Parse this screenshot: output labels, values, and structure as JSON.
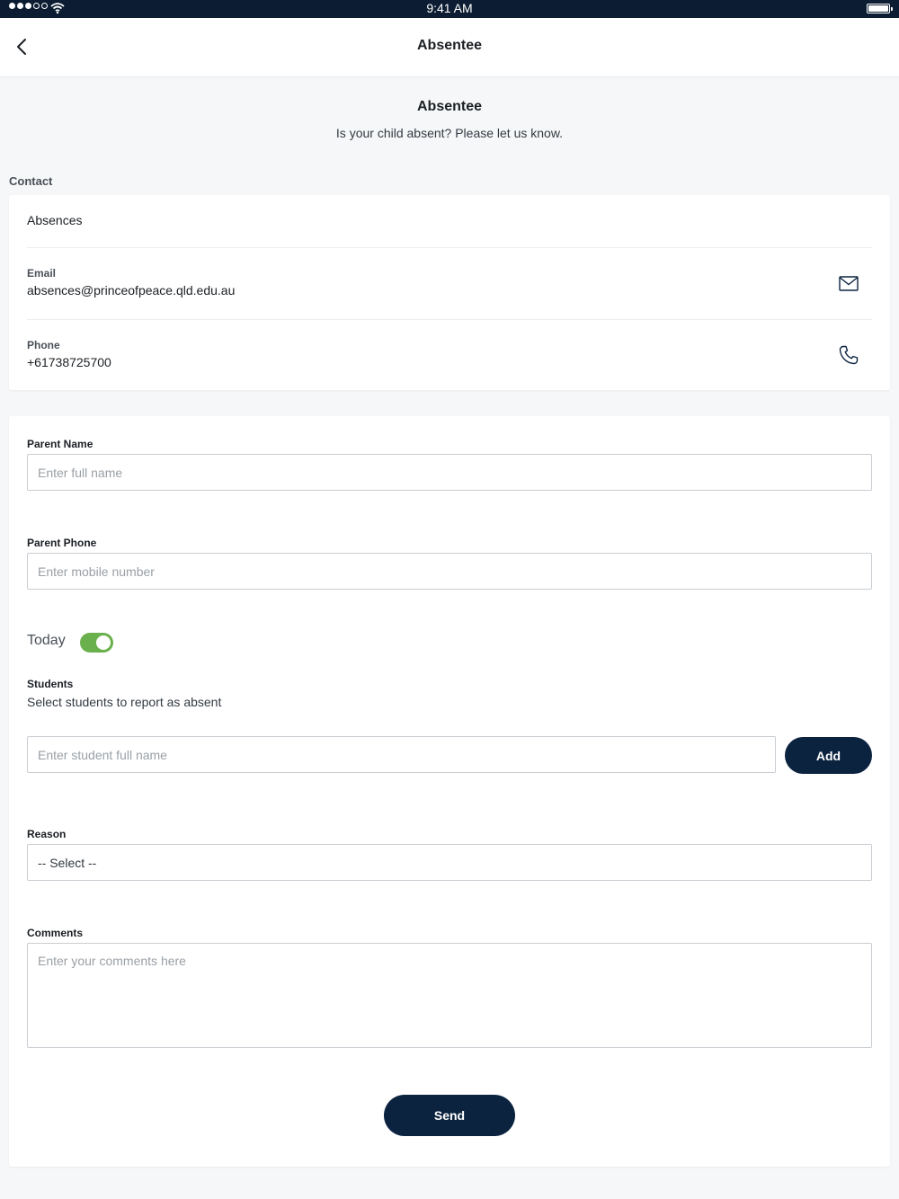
{
  "status_bar": {
    "time": "9:41 AM",
    "signal_icon": "signal-dots-icon",
    "wifi_icon": "wifi-icon",
    "battery_icon": "battery-icon",
    "battery_level": 1.0
  },
  "nav": {
    "title": "Absentee",
    "back_icon": "chevron-left-icon"
  },
  "header": {
    "title": "Absentee",
    "subtitle": "Is your child absent? Please let us know."
  },
  "contact": {
    "section_label": "Contact",
    "heading": "Absences",
    "email": {
      "label": "Email",
      "value": "absences@princeofpeace.qld.edu.au",
      "icon": "mail-icon"
    },
    "phone": {
      "label": "Phone",
      "value": "+61738725700",
      "icon": "phone-icon"
    }
  },
  "form": {
    "parent_name": {
      "label": "Parent Name",
      "placeholder": "Enter full name",
      "value": ""
    },
    "parent_phone": {
      "label": "Parent Phone",
      "placeholder": "Enter mobile number",
      "value": ""
    },
    "today": {
      "label": "Today",
      "on": true
    },
    "students": {
      "label": "Students",
      "subtitle": "Select students to report as absent",
      "placeholder": "Enter student full name",
      "add_label": "Add"
    },
    "reason": {
      "label": "Reason",
      "selected": "-- Select --"
    },
    "comments": {
      "label": "Comments",
      "placeholder": "Enter your comments here"
    },
    "send_label": "Send"
  },
  "colors": {
    "status_bar_bg": "#0c1d33",
    "button_bg": "#0c2340",
    "toggle_on": "#6ab04c",
    "page_bg": "#f6f7f8"
  }
}
